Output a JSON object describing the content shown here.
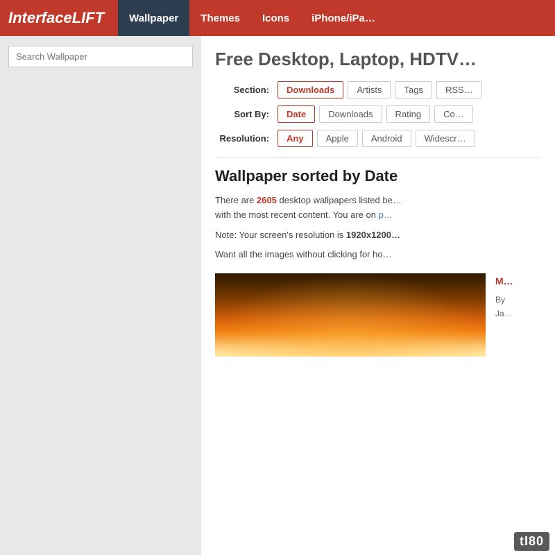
{
  "site": {
    "logo": "InterfaceLIFT",
    "watermark": "tI80"
  },
  "nav": {
    "items": [
      {
        "id": "wallpaper",
        "label": "Wallpaper",
        "active": true
      },
      {
        "id": "themes",
        "label": "Themes",
        "active": false
      },
      {
        "id": "icons",
        "label": "Icons",
        "active": false
      },
      {
        "id": "iphone",
        "label": "iPhone/iPa…",
        "active": false
      }
    ]
  },
  "sidebar": {
    "search_placeholder": "Search Wallpaper"
  },
  "main": {
    "page_title": "Free Desktop, Laptop, HDTV…",
    "section_label": "Section:",
    "section_buttons": [
      {
        "id": "downloads",
        "label": "Downloads",
        "active": true
      },
      {
        "id": "artists",
        "label": "Artists",
        "active": false
      },
      {
        "id": "tags",
        "label": "Tags",
        "active": false
      },
      {
        "id": "rss",
        "label": "RSS…",
        "active": false
      }
    ],
    "sort_label": "Sort By:",
    "sort_buttons": [
      {
        "id": "date",
        "label": "Date",
        "active": true
      },
      {
        "id": "downloads",
        "label": "Downloads",
        "active": false
      },
      {
        "id": "rating",
        "label": "Rating",
        "active": false
      },
      {
        "id": "com",
        "label": "Co…",
        "active": false
      }
    ],
    "resolution_label": "Resolution:",
    "resolution_buttons": [
      {
        "id": "any",
        "label": "Any",
        "active": true
      },
      {
        "id": "apple",
        "label": "Apple",
        "active": false
      },
      {
        "id": "android",
        "label": "Android",
        "active": false
      },
      {
        "id": "widescreen",
        "label": "Widescr…",
        "active": false
      }
    ],
    "section_heading": "Wallpaper sorted by Date",
    "body_line1_prefix": "There are ",
    "body_line1_count": "2605",
    "body_line1_suffix": " desktop wallpapers listed be…",
    "body_line1_suffix2": "with the most recent content. You are on ",
    "body_line1_link": "p…",
    "body_line2_prefix": "Note: Your screen's resolution is ",
    "body_line2_res": "1920x1200…",
    "body_line3": "Want all the images without clicking for ho…",
    "wallpaper": {
      "title": "M…",
      "meta_by": "By",
      "meta_date": "Ja…"
    }
  }
}
